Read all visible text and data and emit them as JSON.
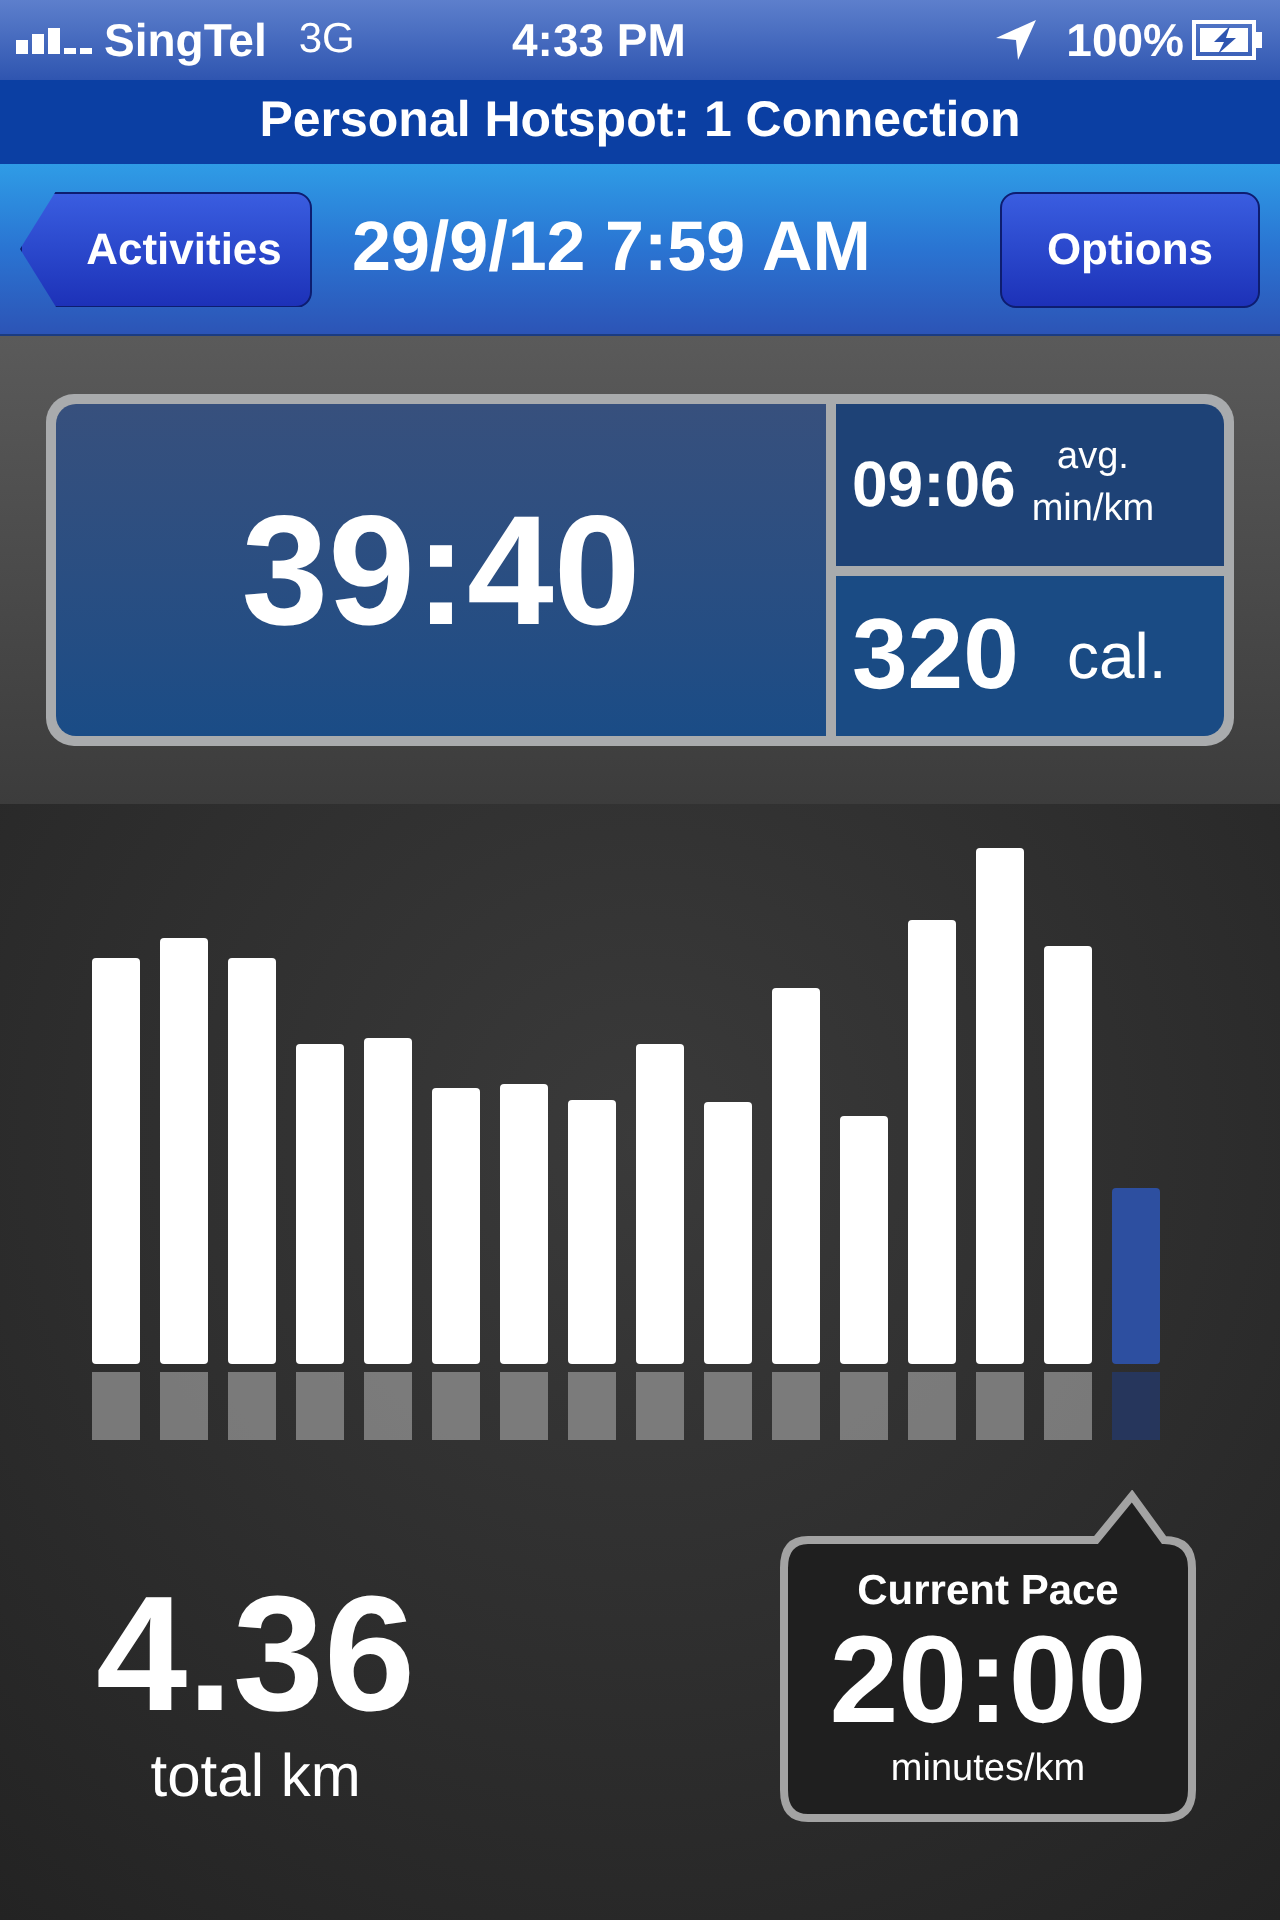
{
  "status_bar": {
    "carrier": "SingTel",
    "network": "3G",
    "time": "4:33 PM",
    "battery": "100%"
  },
  "hotspot_banner": "Personal Hotspot: 1 Connection",
  "nav_bar": {
    "back_button": "Activities",
    "title": "29/9/12 7:59 AM",
    "options_button": "Options"
  },
  "summary": {
    "duration": "39:40",
    "pace": "09:06",
    "pace_unit_1": "avg.",
    "pace_unit_2": "min/km",
    "calories": "320",
    "calories_unit": "cal."
  },
  "distance": {
    "value": "4.36",
    "unit": "total km"
  },
  "current_pace": {
    "label": "Current Pace",
    "value": "20:00",
    "unit": "minutes/km"
  }
}
